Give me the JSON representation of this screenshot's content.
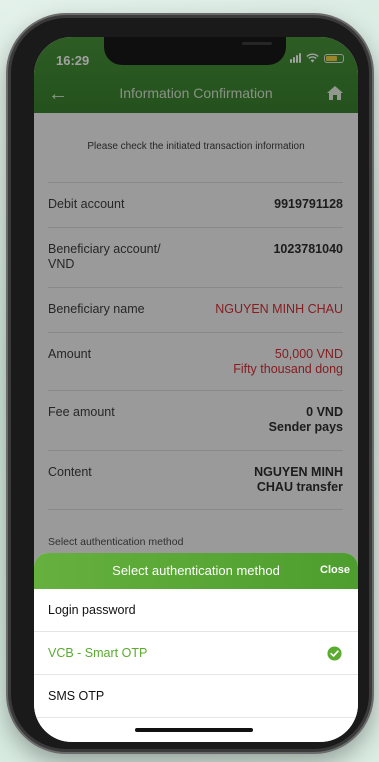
{
  "status_bar": {
    "time": "16:29"
  },
  "header": {
    "title": "Information Confirmation"
  },
  "intro_text": "Please check the initiated transaction information",
  "rows": [
    {
      "label": "Debit account",
      "value": "9919791128"
    },
    {
      "label": "Beneficiary account/ VND",
      "value": "1023781040"
    },
    {
      "label": "Beneficiary name",
      "value": "NGUYEN MINH CHAU"
    },
    {
      "label": "Amount",
      "value": "50,000 VND",
      "value2": "Fifty thousand dong"
    },
    {
      "label": "Fee amount",
      "value": "0 VND",
      "value2": "Sender pays"
    },
    {
      "label": "Content",
      "value": "NGUYEN MINH CHAU transfer"
    }
  ],
  "auth_hint": "Select authentication method",
  "sheet": {
    "title": "Select authentication method",
    "close_label": "Close",
    "options": [
      {
        "label": "Login password",
        "selected": false
      },
      {
        "label": "VCB - Smart OTP",
        "selected": true
      },
      {
        "label": "SMS OTP",
        "selected": false
      }
    ]
  },
  "colors": {
    "brand_green": "#2f7a23",
    "accent_green": "#5aab2f",
    "alert_red": "#d2232a"
  }
}
